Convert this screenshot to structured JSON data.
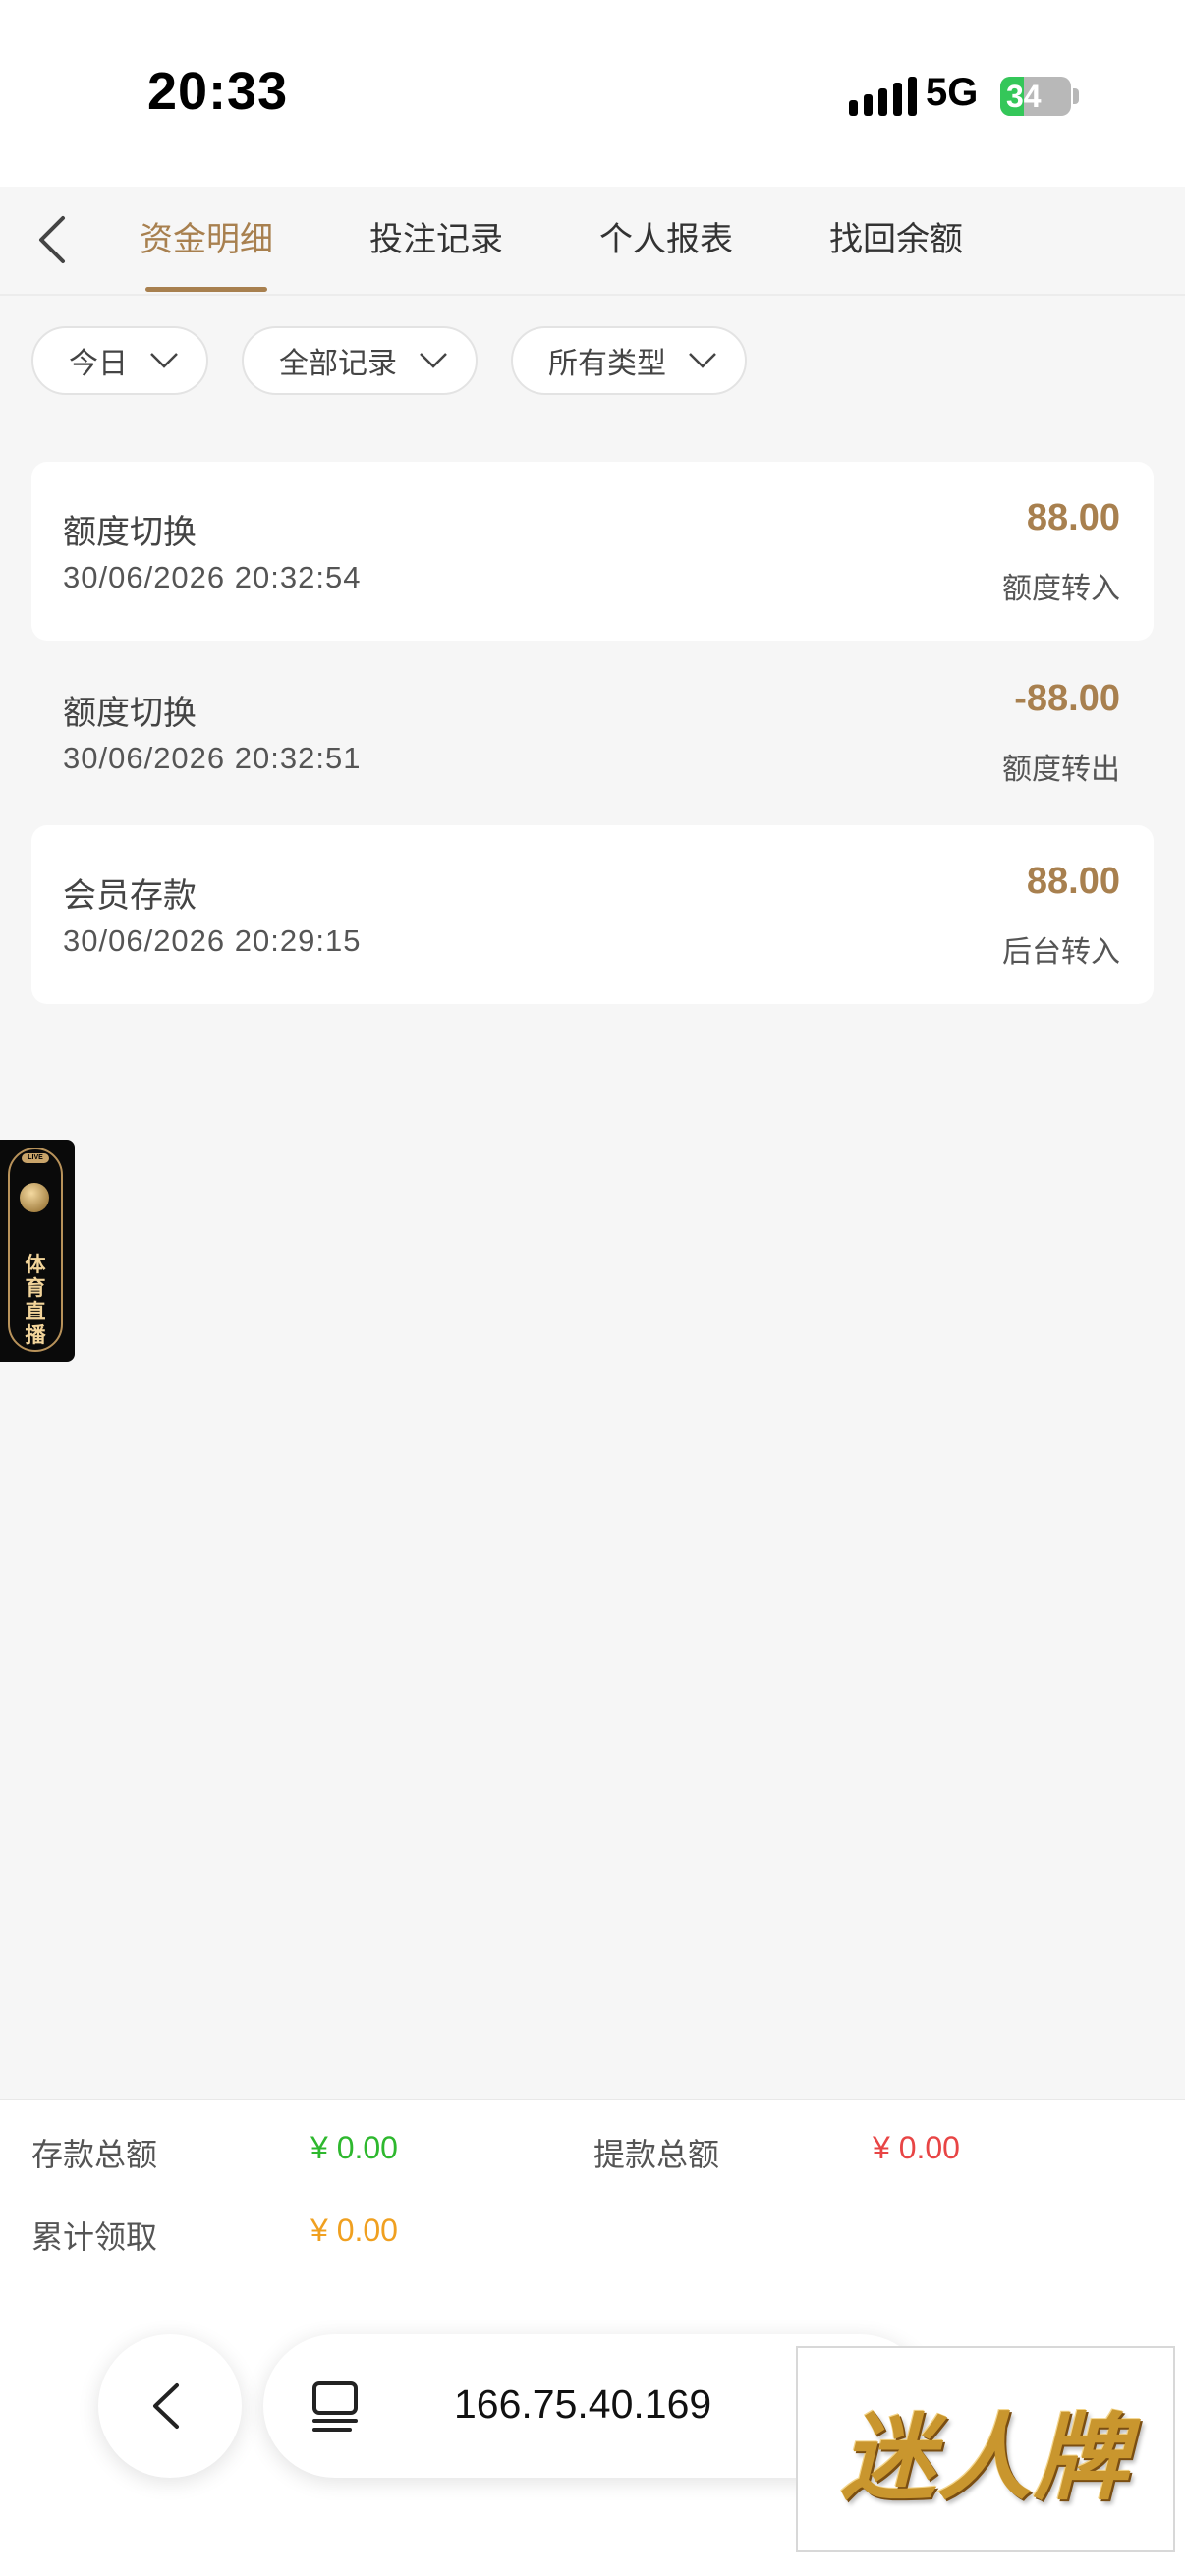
{
  "status_bar": {
    "time": "20:33",
    "network": "5G",
    "battery": "34",
    "battery_level": 0.34
  },
  "header": {
    "tabs": [
      {
        "label": "资金明细",
        "active": true
      },
      {
        "label": "投注记录",
        "active": false
      },
      {
        "label": "个人报表",
        "active": false
      },
      {
        "label": "找回余额",
        "active": false
      }
    ]
  },
  "filters": [
    {
      "label": "今日"
    },
    {
      "label": "全部记录"
    },
    {
      "label": "所有类型"
    }
  ],
  "records": [
    {
      "title": "额度切换",
      "time": "30/06/2026 20:32:54",
      "amount": "88.00",
      "type": "额度转入"
    },
    {
      "title": "额度切换",
      "time": "30/06/2026 20:32:51",
      "amount": "-88.00",
      "type": "额度转出"
    },
    {
      "title": "会员存款",
      "time": "30/06/2026 20:29:15",
      "amount": "88.00",
      "type": "后台转入"
    }
  ],
  "live_banner": {
    "badge": "LIVE",
    "text": "体育直播"
  },
  "summary": {
    "deposit_label": "存款总额",
    "deposit_value": "¥ 0.00",
    "withdraw_label": "提款总额",
    "withdraw_value": "¥ 0.00",
    "claimed_label": "累计领取",
    "claimed_value": "¥ 0.00"
  },
  "browser": {
    "url": "166.75.40.169"
  },
  "ad": {
    "text": "迷人牌"
  },
  "colors": {
    "accent": "#a8804f",
    "deposit": "#2eb82e",
    "withdraw": "#e84545",
    "claimed": "#f0a020"
  }
}
